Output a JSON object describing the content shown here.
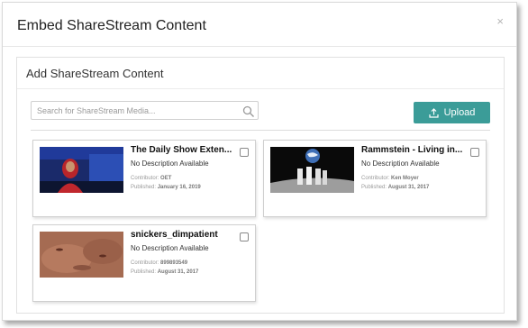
{
  "dialog": {
    "title": "Embed ShareStream Content",
    "close_label": "×"
  },
  "panel": {
    "title": "Add ShareStream Content"
  },
  "search": {
    "placeholder": "Search for ShareStream Media..."
  },
  "upload": {
    "label": "Upload"
  },
  "colors": {
    "accent": "#3b9c98"
  },
  "cards": [
    {
      "title": "The Daily Show Exten...",
      "description": "No Description Available",
      "contributor_label": "Contributor:",
      "contributor": "OET",
      "published_label": "Published:",
      "published": "January 16, 2019"
    },
    {
      "title": "Rammstein - Living in...",
      "description": "No Description Available",
      "contributor_label": "Contributor:",
      "contributor": "Ken Moyer",
      "published_label": "Published:",
      "published": "August 31, 2017"
    },
    {
      "title": "snickers_dimpatient",
      "description": "No Description Available",
      "contributor_label": "Contributor:",
      "contributor": "899893549",
      "published_label": "Published:",
      "published": "August 31, 2017"
    }
  ]
}
